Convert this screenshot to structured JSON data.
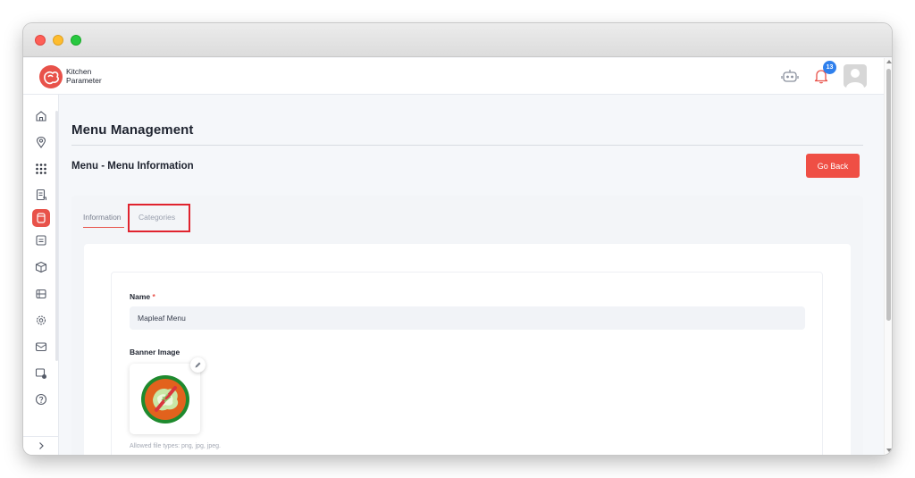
{
  "brand": {
    "line1": "Kitchen",
    "line2": "Parameter"
  },
  "topbar": {
    "notification_count": "13"
  },
  "page": {
    "title": "Menu Management",
    "section_title": "Menu - Menu Information",
    "go_back_label": "Go Back"
  },
  "tabs": [
    {
      "label": "Information",
      "active": true
    },
    {
      "label": "Categories",
      "active": false
    }
  ],
  "form": {
    "name_label": "Name",
    "required_mark": "*",
    "name_value": "Mapleaf Menu",
    "banner_label": "Banner Image",
    "file_hint": "Allowed file types: png, jpg, jpeg."
  },
  "sidebar": {
    "items": [
      "home-icon",
      "location-pin-icon",
      "grid-dots-icon",
      "document-icon",
      "menu-book-icon",
      "calendar-list-icon",
      "box-icon",
      "receipt-icon",
      "gear-icon",
      "mail-icon",
      "settings-panel-icon",
      "help-icon"
    ],
    "active_index": 4
  },
  "colors": {
    "accent": "#e8524a",
    "badge": "#2f80ed",
    "highlight": "#e0232e"
  }
}
